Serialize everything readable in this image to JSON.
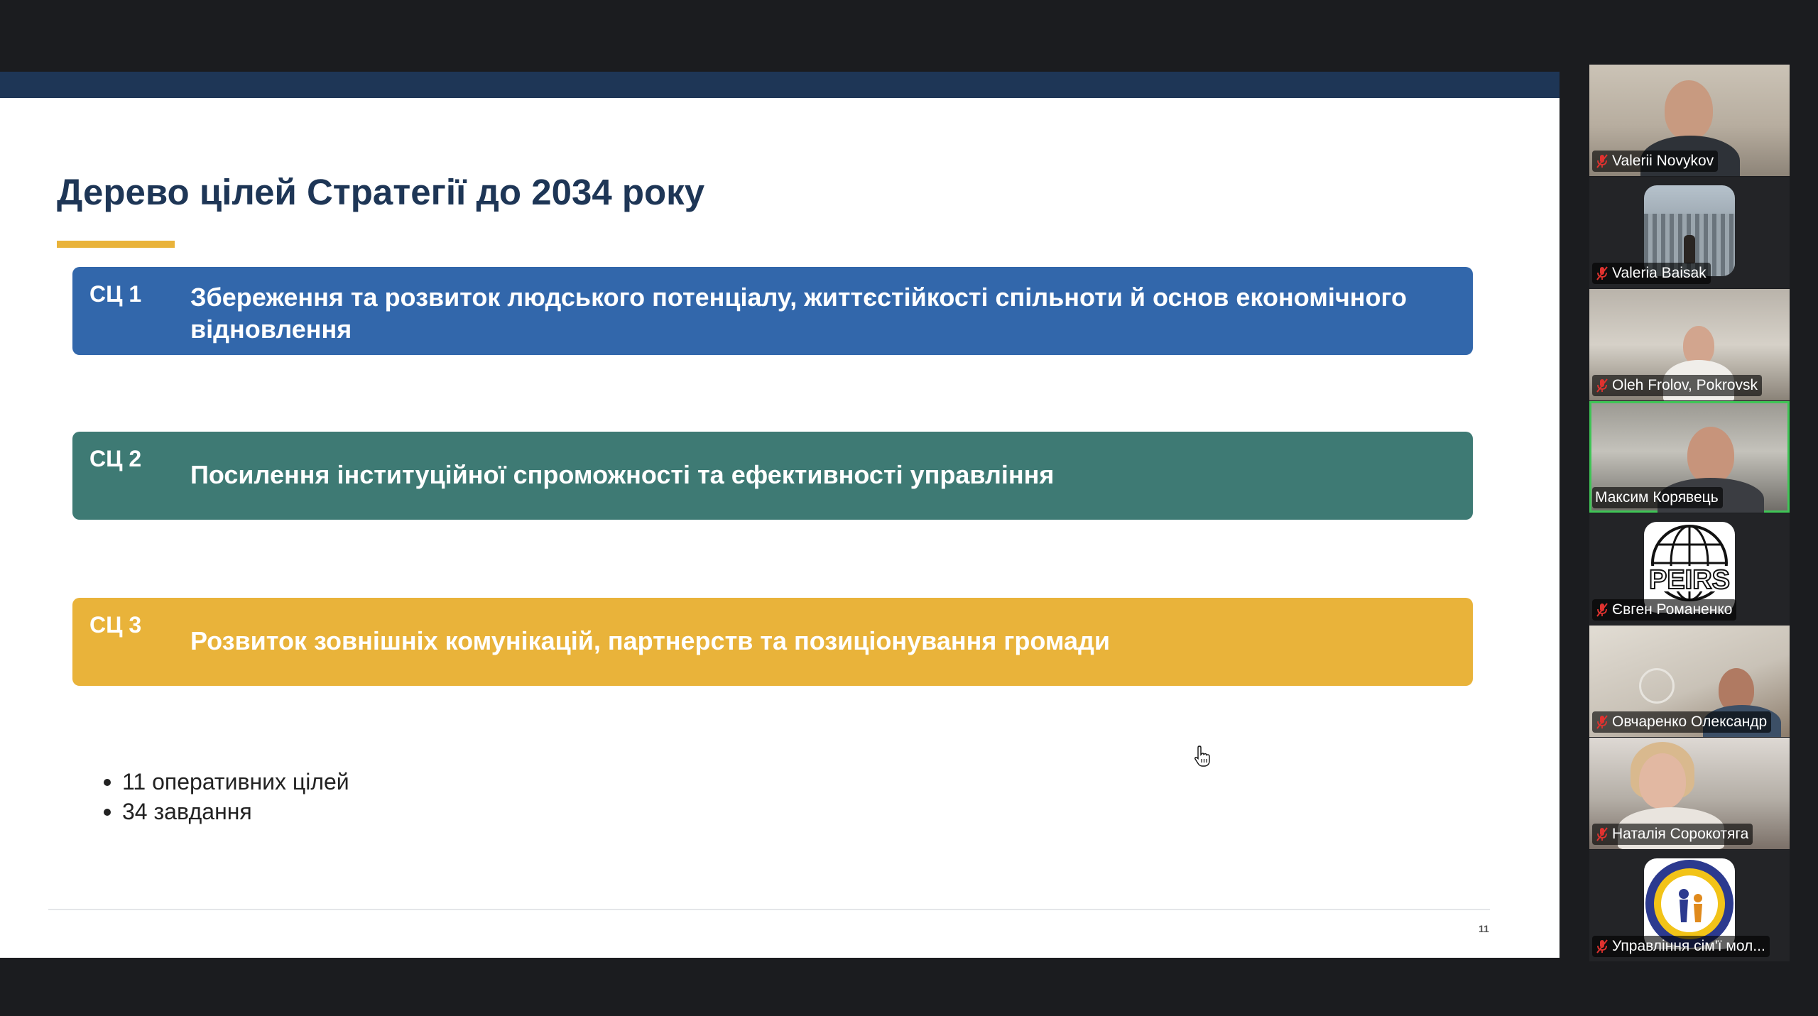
{
  "slide": {
    "title": "Дерево цілей Стратегії до 2034 року",
    "goals": [
      {
        "code": "СЦ 1",
        "text": "Збереження та розвиток людського потенціалу, життєстійкості спільноти й основ економічного відновлення",
        "color": "#3267ab"
      },
      {
        "code": "СЦ 2",
        "text": "Посилення інституційної спроможності та ефективності управління",
        "color": "#3e7a74"
      },
      {
        "code": "СЦ 3",
        "text": "Розвиток зовнішніх комунікацій, партнерств та позиціонування громади",
        "color": "#e9b33a"
      }
    ],
    "bullets": [
      "11 оперативних цілей",
      "34 завдання"
    ],
    "page_number": "11"
  },
  "participants": [
    {
      "name": "Valerii Novykov",
      "muted": true,
      "icon": "video"
    },
    {
      "name": "Valeria Baisak",
      "muted": true,
      "icon": "avatar-photo"
    },
    {
      "name": "Oleh Frolov, Pokrovsk",
      "muted": true,
      "icon": "video"
    },
    {
      "name": "Максим Корявець",
      "muted": false,
      "active_speaker": true,
      "icon": "video"
    },
    {
      "name": "Євген Романенко",
      "muted": true,
      "icon": "peirs-logo"
    },
    {
      "name": "Овчаренко Олександр",
      "muted": true,
      "icon": "video"
    },
    {
      "name": "Наталія Сорокотяга",
      "muted": true,
      "icon": "video"
    },
    {
      "name": "Управління сім'ї мол...",
      "muted": true,
      "icon": "department-emblem"
    }
  ],
  "colors": {
    "slide_bar": "#1e3656",
    "accent": "#e9b33a",
    "active_speaker_border": "#3fc556",
    "muted_icon": "#e0322f"
  }
}
